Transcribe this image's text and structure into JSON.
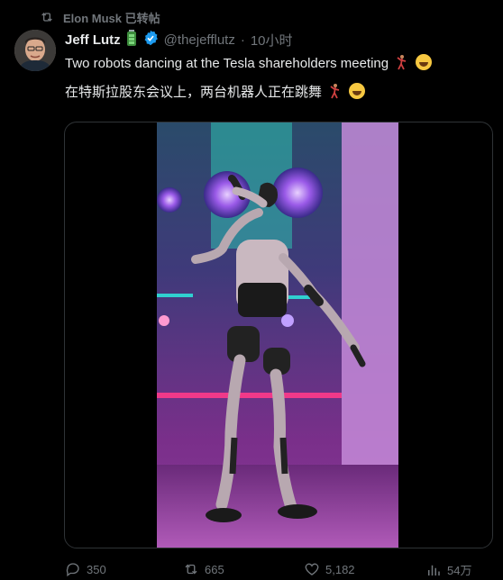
{
  "repost": {
    "label": "Elon Musk 已转帖",
    "icon": "repost-icon"
  },
  "author": {
    "name": "Jeff Lutz",
    "handle": "@thejefflutz",
    "separator": "·",
    "time": "10小时",
    "badges": [
      "battery-emoji-icon",
      "verified-badge-icon"
    ],
    "verified_color": "#1d9bf0"
  },
  "tweet": {
    "line1": "Two robots dancing at the Tesla shareholders meeting",
    "line2": "在特斯拉股东会议上，两台机器人正在跳舞"
  },
  "media": {
    "type": "video",
    "description_icon": "robot-dancing-video"
  },
  "actions": {
    "replies": "350",
    "reposts": "665",
    "likes": "5,182",
    "views": "54万"
  },
  "colors": {
    "background": "#000000",
    "text": "#e7e9ea",
    "muted": "#71767b",
    "border": "#2f3336"
  }
}
